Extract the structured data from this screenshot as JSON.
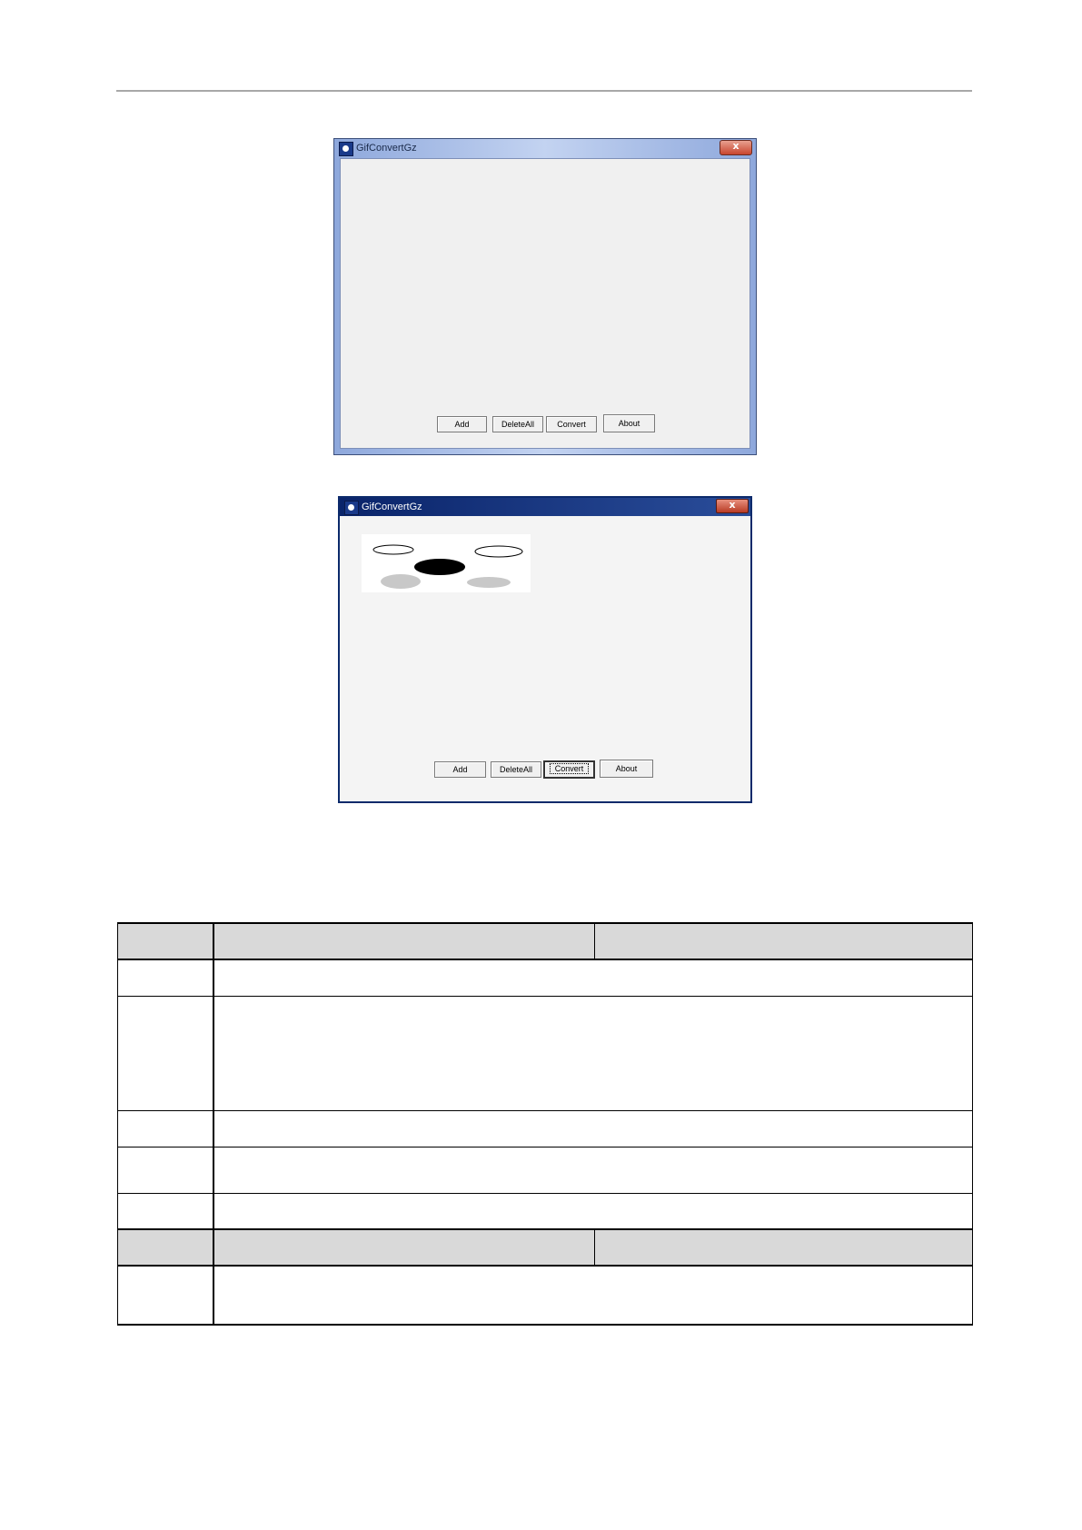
{
  "windows": [
    {
      "title": "GifConvertGz",
      "close_glyph": "x",
      "buttons": [
        {
          "label": "Add"
        },
        {
          "label": "DeleteAll"
        },
        {
          "label": "Convert"
        },
        {
          "label": "About"
        }
      ]
    },
    {
      "title": "GifConvertGz",
      "close_glyph": "x",
      "buttons": [
        {
          "label": "Add"
        },
        {
          "label": "DeleteAll"
        },
        {
          "label": "Convert"
        },
        {
          "label": "About"
        }
      ],
      "default_button": "Convert"
    }
  ],
  "table": {
    "rows": [
      {
        "type": "header",
        "cells": [
          "",
          "",
          ""
        ]
      },
      {
        "type": "body",
        "cells": [
          "",
          ""
        ]
      },
      {
        "type": "body",
        "cells": [
          "",
          ""
        ]
      },
      {
        "type": "body",
        "cells": [
          "",
          ""
        ]
      },
      {
        "type": "body",
        "cells": [
          "",
          ""
        ]
      },
      {
        "type": "body",
        "cells": [
          "",
          ""
        ]
      },
      {
        "type": "header",
        "cells": [
          "",
          "",
          ""
        ]
      },
      {
        "type": "body",
        "cells": [
          "",
          ""
        ]
      }
    ]
  },
  "colors": {
    "header_row_fill": "#d9d9d9",
    "win1_frame": "#8ea8dc",
    "win2_titlebar": "#0a246a",
    "close_button": "#c8452e"
  }
}
